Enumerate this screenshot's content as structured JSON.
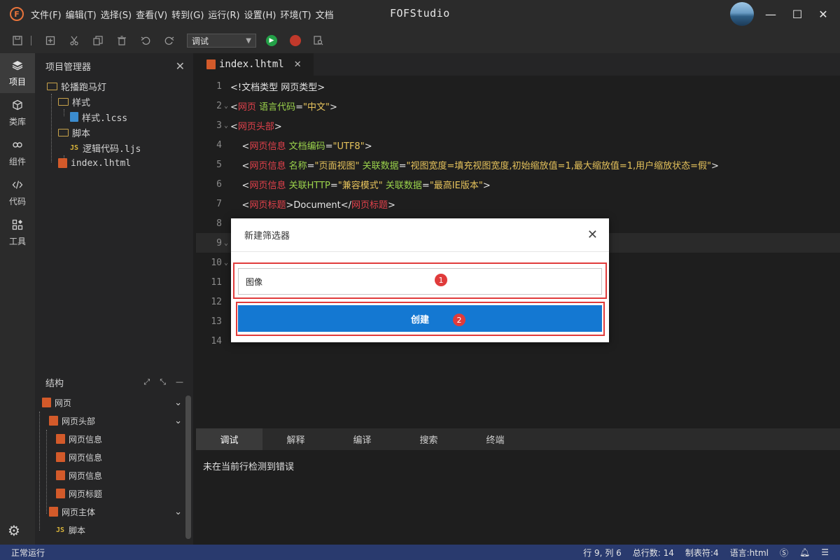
{
  "titlebar": {
    "logo_letter": "F",
    "menu": [
      "文件(F)",
      "编辑(T)",
      "选择(S)",
      "查看(V)",
      "转到(G)",
      "运行(R)",
      "设置(H)",
      "环境(T)",
      "文档"
    ],
    "app_title": "FOFStudio",
    "minimize": "—",
    "maximize": "☐",
    "close": "✕"
  },
  "toolbar": {
    "select_value": "调试"
  },
  "activity": {
    "items": [
      {
        "label": "项目",
        "icon": "layers-icon",
        "active": true
      },
      {
        "label": "类库",
        "icon": "box-icon",
        "active": false
      },
      {
        "label": "组件",
        "icon": "link-icon",
        "active": false
      },
      {
        "label": "代码",
        "icon": "code-icon",
        "active": false
      },
      {
        "label": "工具",
        "icon": "tools-icon",
        "active": false
      }
    ],
    "settings_icon": "gear-icon"
  },
  "project": {
    "title": "项目管理器",
    "root": "轮播跑马灯",
    "folder_style": "样式",
    "file_css": "样式.lcss",
    "folder_script": "脚本",
    "file_js": "逻辑代码.ljs",
    "file_html": "index.lhtml",
    "js_badge": "JS"
  },
  "structure": {
    "title": "结构",
    "items": [
      "网页",
      "网页头部",
      "网页信息",
      "网页信息",
      "网页信息",
      "网页标题",
      "网页主体",
      "脚本"
    ],
    "js_badge": "JS"
  },
  "editor": {
    "tab_label": "index.lhtml",
    "line_numbers": [
      "1",
      "2",
      "3",
      "4",
      "5",
      "6",
      "7",
      "8",
      "9",
      "10",
      "11",
      "12",
      "13",
      "14"
    ],
    "current_line": 9
  },
  "bottom": {
    "tabs": [
      "调试",
      "解释",
      "编译",
      "搜索",
      "终端"
    ],
    "active_tab": "调试",
    "message": "未在当前行检测到错误"
  },
  "statusbar": {
    "left": "正常运行",
    "position": "行 9, 列 6",
    "total_lines": "总行数: 14",
    "tab_size": "制表符:4",
    "language": "语言:html"
  },
  "modal": {
    "title": "新建筛选器",
    "input_value": "图像",
    "button_label": "创建",
    "badge_1": "1",
    "badge_2": "2"
  },
  "colors": {
    "accent_blue": "#1478d2",
    "highlight_red": "#e03b3b",
    "statusbar": "#293a6e",
    "tag": "#e2414b",
    "attr": "#9ad14b",
    "string": "#e6c35c"
  }
}
